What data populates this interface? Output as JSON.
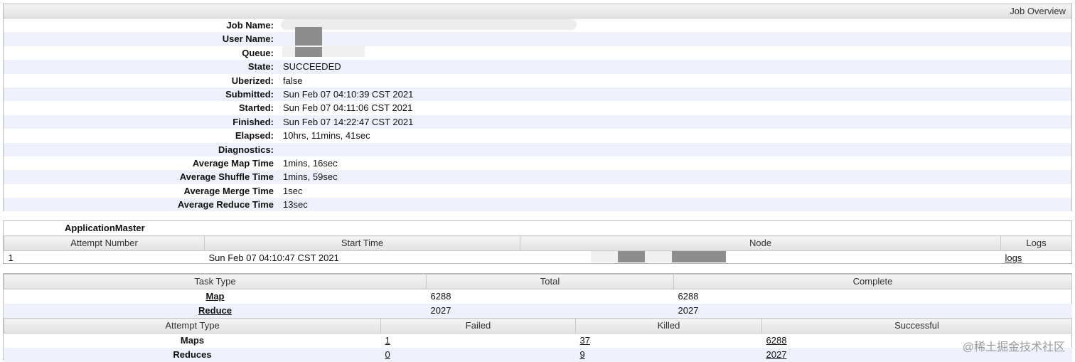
{
  "overview": {
    "header": "Job Overview",
    "rows": [
      {
        "key": "Job Name:",
        "value": ""
      },
      {
        "key": "User Name:",
        "value": ""
      },
      {
        "key": "Queue:",
        "value": ""
      },
      {
        "key": "State:",
        "value": "SUCCEEDED"
      },
      {
        "key": "Uberized:",
        "value": "false"
      },
      {
        "key": "Submitted:",
        "value": "Sun Feb 07 04:10:39 CST 2021"
      },
      {
        "key": "Started:",
        "value": "Sun Feb 07 04:11:06 CST 2021"
      },
      {
        "key": "Finished:",
        "value": "Sun Feb 07 14:22:47 CST 2021"
      },
      {
        "key": "Elapsed:",
        "value": "10hrs, 11mins, 41sec"
      },
      {
        "key": "Diagnostics:",
        "value": ""
      },
      {
        "key": "Average Map Time",
        "value": "1mins, 16sec"
      },
      {
        "key": "Average Shuffle Time",
        "value": "1mins, 59sec"
      },
      {
        "key": "Average Merge Time",
        "value": "1sec"
      },
      {
        "key": "Average Reduce Time",
        "value": "13sec"
      }
    ]
  },
  "app_master": {
    "title": "ApplicationMaster",
    "columns": [
      "Attempt Number",
      "Start Time",
      "Node",
      "Logs"
    ],
    "row": {
      "attempt": "1",
      "start": "Sun Feb 07 04:10:47 CST 2021",
      "node": "",
      "logs": "logs"
    }
  },
  "tasks": {
    "columns": [
      "Task Type",
      "Total",
      "Complete"
    ],
    "rows": [
      {
        "type": "Map",
        "total": "6288",
        "complete": "6288"
      },
      {
        "type": "Reduce",
        "total": "2027",
        "complete": "2027"
      }
    ]
  },
  "attempts": {
    "columns": [
      "Attempt Type",
      "Failed",
      "Killed",
      "Successful"
    ],
    "rows": [
      {
        "type": "Maps",
        "failed": "1",
        "killed": "37",
        "successful": "6288"
      },
      {
        "type": "Reduces",
        "failed": "0",
        "killed": "9",
        "successful": "2027"
      }
    ]
  },
  "watermark": "@稀土掘金技术社区"
}
